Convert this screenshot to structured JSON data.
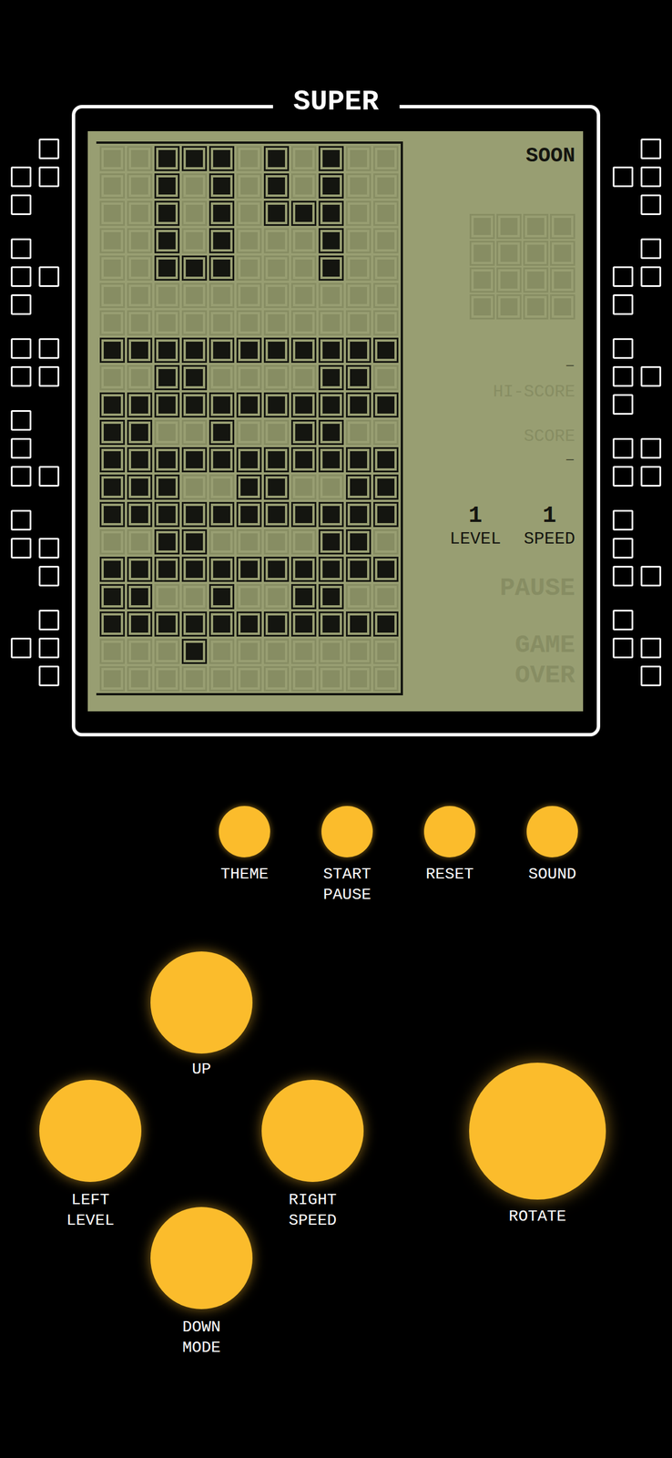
{
  "title": "SUPER",
  "board": {
    "rows": [
      [
        0,
        0,
        1,
        1,
        1,
        0,
        1,
        0,
        1,
        0,
        0
      ],
      [
        0,
        0,
        1,
        0,
        1,
        0,
        1,
        0,
        1,
        0,
        0
      ],
      [
        0,
        0,
        1,
        0,
        1,
        0,
        1,
        1,
        1,
        0,
        0
      ],
      [
        0,
        0,
        1,
        0,
        1,
        0,
        0,
        0,
        1,
        0,
        0
      ],
      [
        0,
        0,
        1,
        1,
        1,
        0,
        0,
        0,
        1,
        0,
        0
      ],
      [
        0,
        0,
        0,
        0,
        0,
        0,
        0,
        0,
        0,
        0,
        0
      ],
      [
        0,
        0,
        0,
        0,
        0,
        0,
        0,
        0,
        0,
        0,
        0
      ],
      [
        1,
        1,
        1,
        1,
        1,
        1,
        1,
        1,
        1,
        1,
        1
      ],
      [
        0,
        0,
        1,
        1,
        0,
        0,
        0,
        0,
        1,
        1,
        0
      ],
      [
        1,
        1,
        1,
        1,
        1,
        1,
        1,
        1,
        1,
        1,
        1
      ],
      [
        1,
        1,
        0,
        0,
        1,
        0,
        0,
        1,
        1,
        0,
        0
      ],
      [
        1,
        1,
        1,
        1,
        1,
        1,
        1,
        1,
        1,
        1,
        1
      ],
      [
        1,
        1,
        1,
        0,
        0,
        1,
        1,
        0,
        0,
        1,
        1
      ],
      [
        1,
        1,
        1,
        1,
        1,
        1,
        1,
        1,
        1,
        1,
        1
      ],
      [
        0,
        0,
        1,
        1,
        0,
        0,
        0,
        0,
        1,
        1,
        0
      ],
      [
        1,
        1,
        1,
        1,
        1,
        1,
        1,
        1,
        1,
        1,
        1
      ],
      [
        1,
        1,
        0,
        0,
        1,
        0,
        0,
        1,
        1,
        0,
        0
      ],
      [
        1,
        1,
        1,
        1,
        1,
        1,
        1,
        1,
        1,
        1,
        1
      ],
      [
        0,
        0,
        0,
        1,
        0,
        0,
        0,
        0,
        0,
        0,
        0
      ],
      [
        0,
        0,
        0,
        0,
        0,
        0,
        0,
        0,
        0,
        0,
        0
      ]
    ]
  },
  "next": {
    "label": "SOON",
    "rows": [
      [
        0,
        0,
        0,
        0
      ],
      [
        0,
        0,
        0,
        0
      ],
      [
        0,
        0,
        0,
        0
      ],
      [
        0,
        0,
        0,
        0
      ]
    ]
  },
  "hi_score": {
    "value": "–",
    "label": "HI-SCORE",
    "label_lit": false
  },
  "score": {
    "label": "SCORE",
    "value": "–",
    "label_lit": false
  },
  "stats": [
    {
      "value": "1",
      "label": "LEVEL"
    },
    {
      "value": "1",
      "label": "SPEED"
    }
  ],
  "indicators": [
    {
      "lines": [
        "PAUSE"
      ],
      "lit": false
    },
    {
      "lines": [
        "GAME",
        "OVER"
      ],
      "lit": false
    }
  ],
  "function_buttons": [
    {
      "lines": [
        "THEME"
      ]
    },
    {
      "lines": [
        "START",
        "PAUSE"
      ]
    },
    {
      "lines": [
        "RESET"
      ]
    },
    {
      "lines": [
        "SOUND"
      ]
    }
  ],
  "controls": {
    "up": {
      "lines": [
        "UP"
      ]
    },
    "left": {
      "lines": [
        "LEFT",
        "LEVEL"
      ]
    },
    "right": {
      "lines": [
        "RIGHT",
        "SPEED"
      ]
    },
    "down": {
      "lines": [
        "DOWN",
        "MODE"
      ]
    },
    "rotate": {
      "lines": [
        "ROTATE"
      ]
    }
  }
}
